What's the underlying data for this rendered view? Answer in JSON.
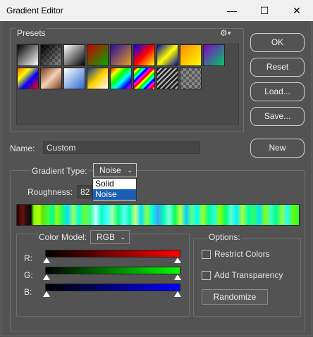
{
  "window": {
    "title": "Gradient Editor",
    "controls": [
      "—",
      "☐",
      "✕"
    ]
  },
  "presets": {
    "label": "Presets",
    "menu_icon": "gear-icon",
    "menu_caret": "▾"
  },
  "buttons": {
    "ok": "OK",
    "reset": "Reset",
    "load": "Load...",
    "save": "Save...",
    "new": "New",
    "randomize": "Randomize"
  },
  "name": {
    "label": "Name:",
    "value": "Custom"
  },
  "gradient_type": {
    "label": "Gradient Type:",
    "value": "Noise",
    "options": [
      "Solid",
      "Noise"
    ],
    "selected": "Noise"
  },
  "roughness": {
    "label": "Roughness:",
    "value": "82"
  },
  "color_model": {
    "label": "Color Model:",
    "value": "RGB",
    "channels": [
      {
        "label": "R:"
      },
      {
        "label": "G:"
      },
      {
        "label": "B:"
      }
    ]
  },
  "options": {
    "label": "Options:",
    "restrict_colors": "Restrict Colors",
    "add_transparency": "Add Transparency"
  },
  "colors": {
    "accent": "#1a5fb4",
    "background": "#535353"
  }
}
